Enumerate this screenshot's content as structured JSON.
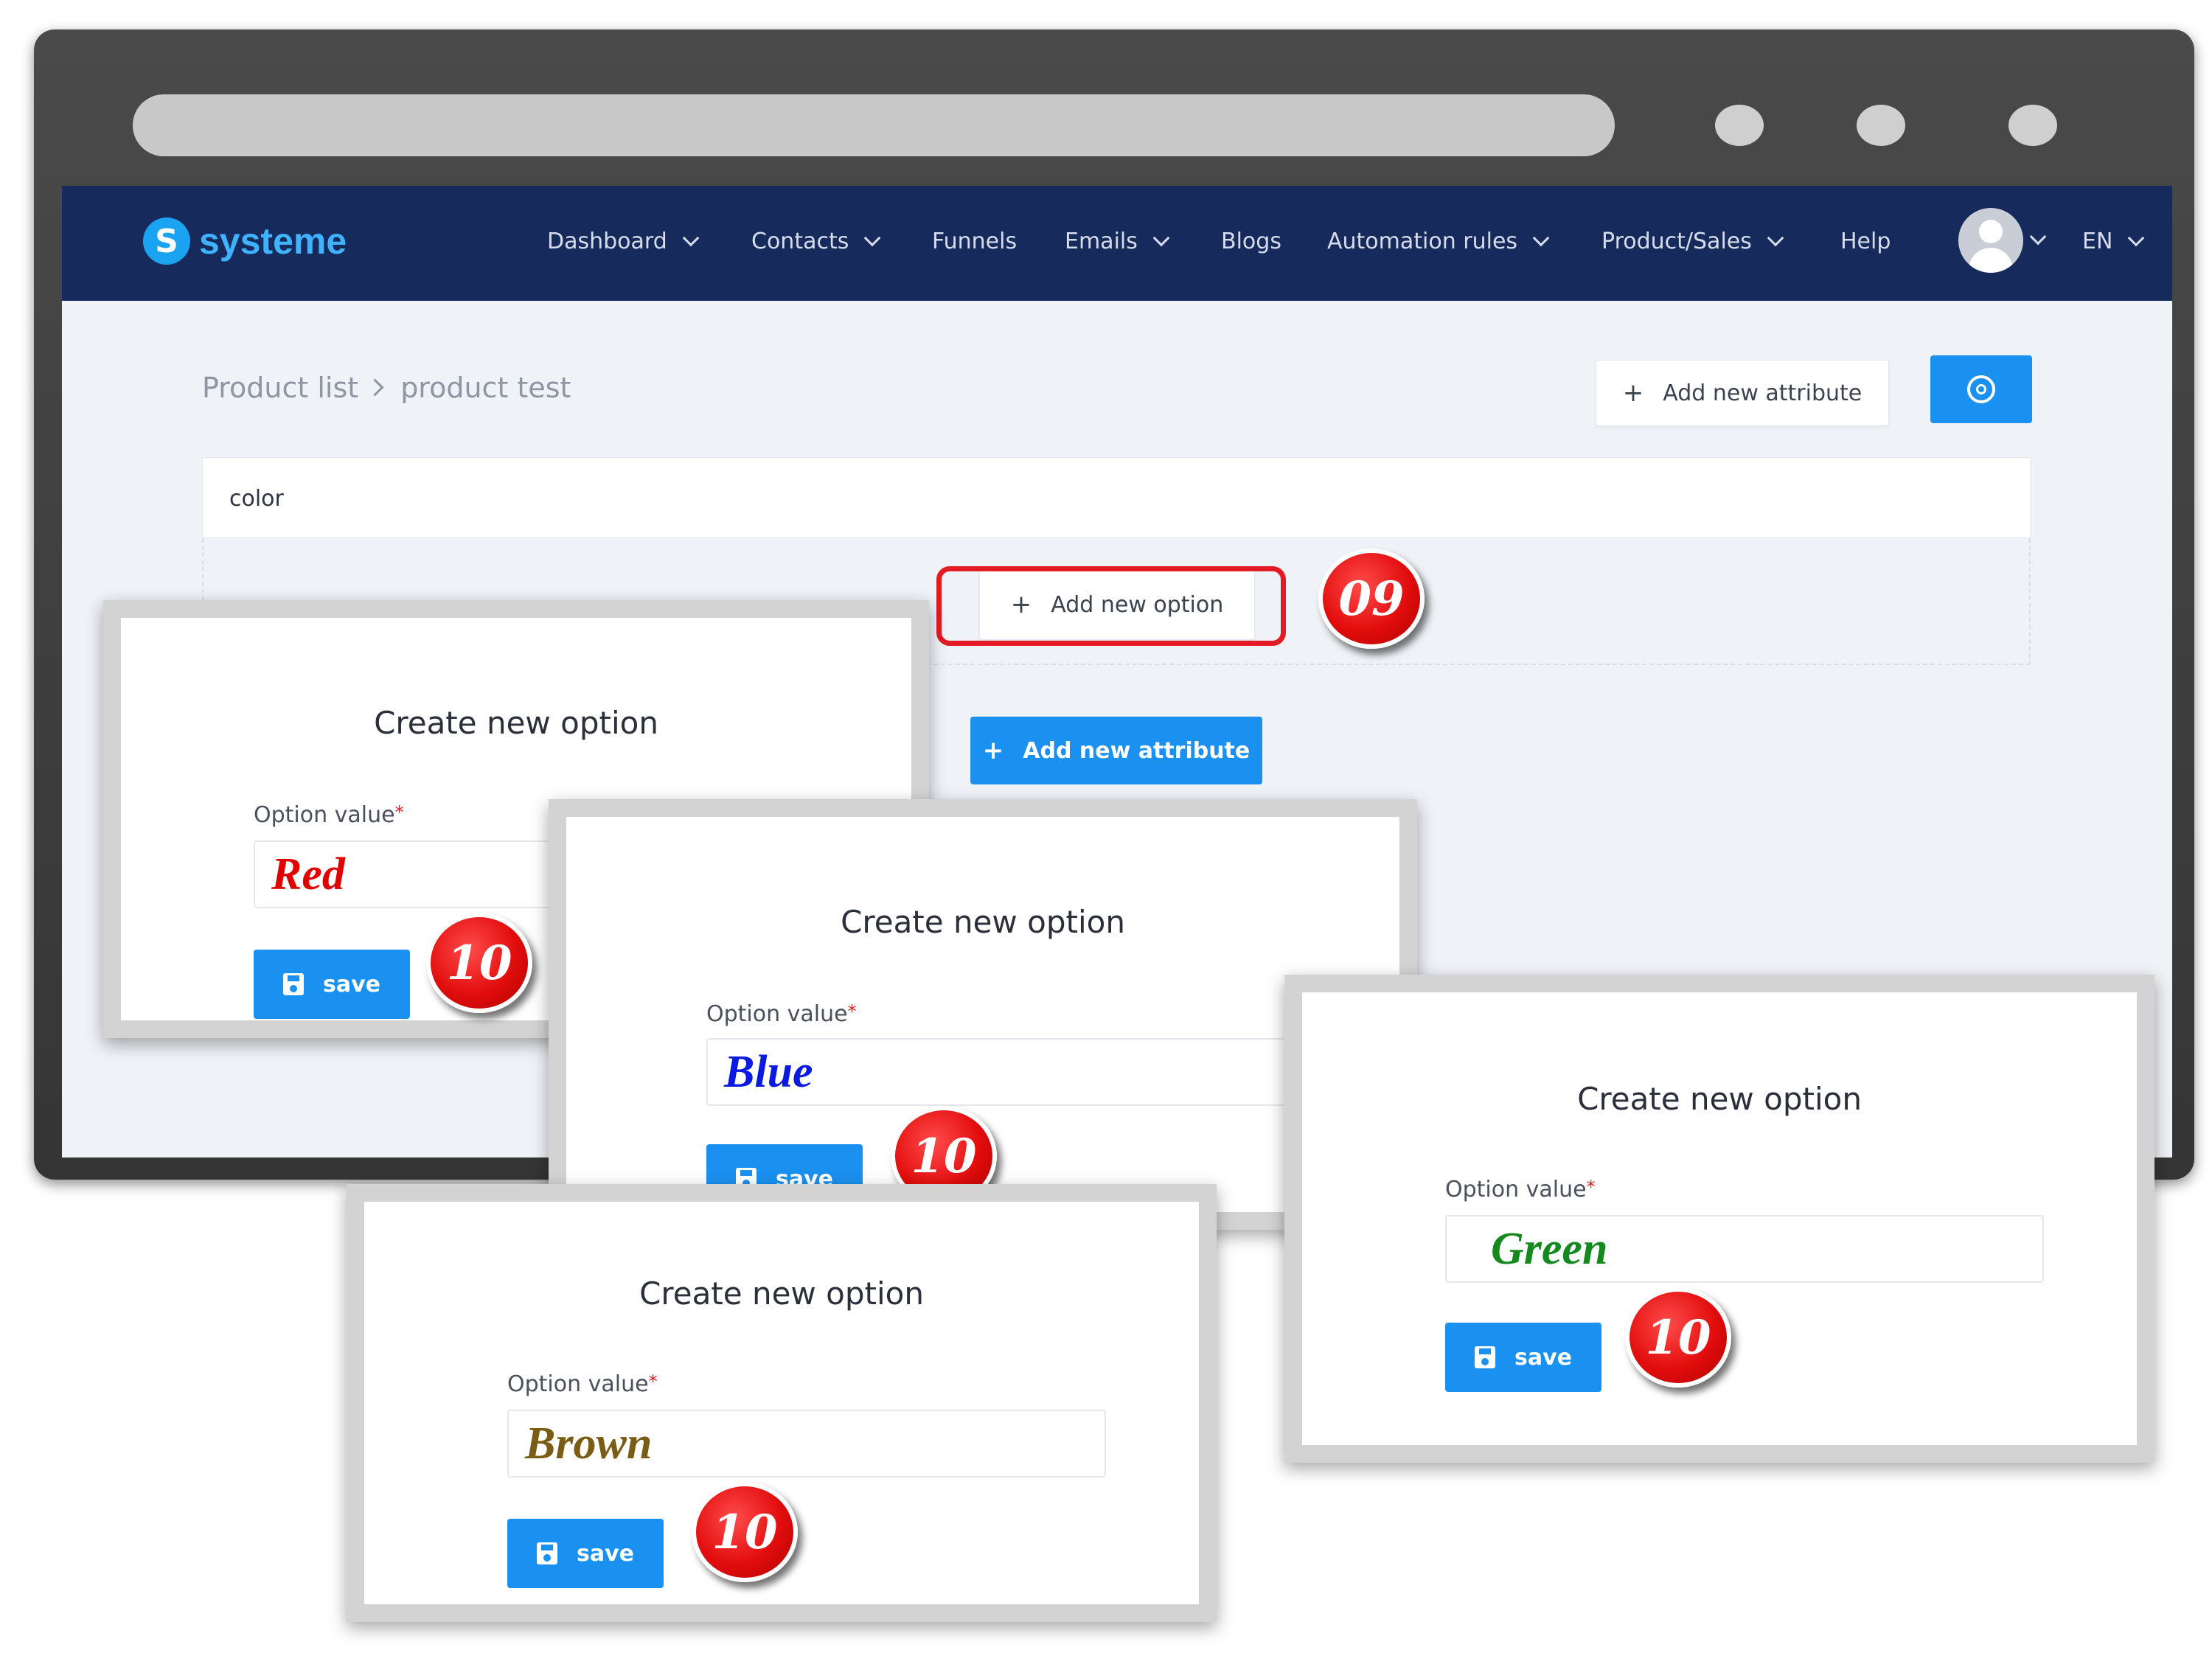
{
  "brand": {
    "name": "systeme",
    "mark": "S",
    "accent": "#1a90f0",
    "nav_bg": "#162a5c"
  },
  "nav": {
    "items": [
      {
        "label": "Dashboard",
        "dropdown": true
      },
      {
        "label": "Contacts",
        "dropdown": true
      },
      {
        "label": "Funnels",
        "dropdown": false
      },
      {
        "label": "Emails",
        "dropdown": true
      },
      {
        "label": "Blogs",
        "dropdown": false
      },
      {
        "label": "Automation rules",
        "dropdown": true
      },
      {
        "label": "Product/Sales",
        "dropdown": true
      },
      {
        "label": "Help",
        "dropdown": false
      }
    ],
    "language": "EN"
  },
  "breadcrumb": {
    "parent": "Product list",
    "current": "product test"
  },
  "toolbar": {
    "add_attribute_label": "Add new attribute",
    "settings_icon": "gear-icon"
  },
  "attribute": {
    "name": "color",
    "add_option_label": "Add new option"
  },
  "add_attribute_label": "Add new attribute",
  "steps": {
    "add_option": "09",
    "save": "10"
  },
  "dialogs": [
    {
      "title": "Create new option",
      "label": "Option value",
      "required": "*",
      "value": "Red",
      "value_color": "#e00000",
      "save_label": "save",
      "step": "10"
    },
    {
      "title": "Create new option",
      "label": "Option value",
      "required": "*",
      "value": "Blue",
      "value_color": "#0a1ae0",
      "save_label": "save",
      "step": "10"
    },
    {
      "title": "Create new option",
      "label": "Option value",
      "required": "*",
      "value": "Green",
      "value_color": "#148a1e",
      "save_label": "save",
      "step": "10"
    },
    {
      "title": "Create new option",
      "label": "Option value",
      "required": "*",
      "value": "Brown",
      "value_color": "#7a5c14",
      "save_label": "save",
      "step": "10"
    }
  ]
}
